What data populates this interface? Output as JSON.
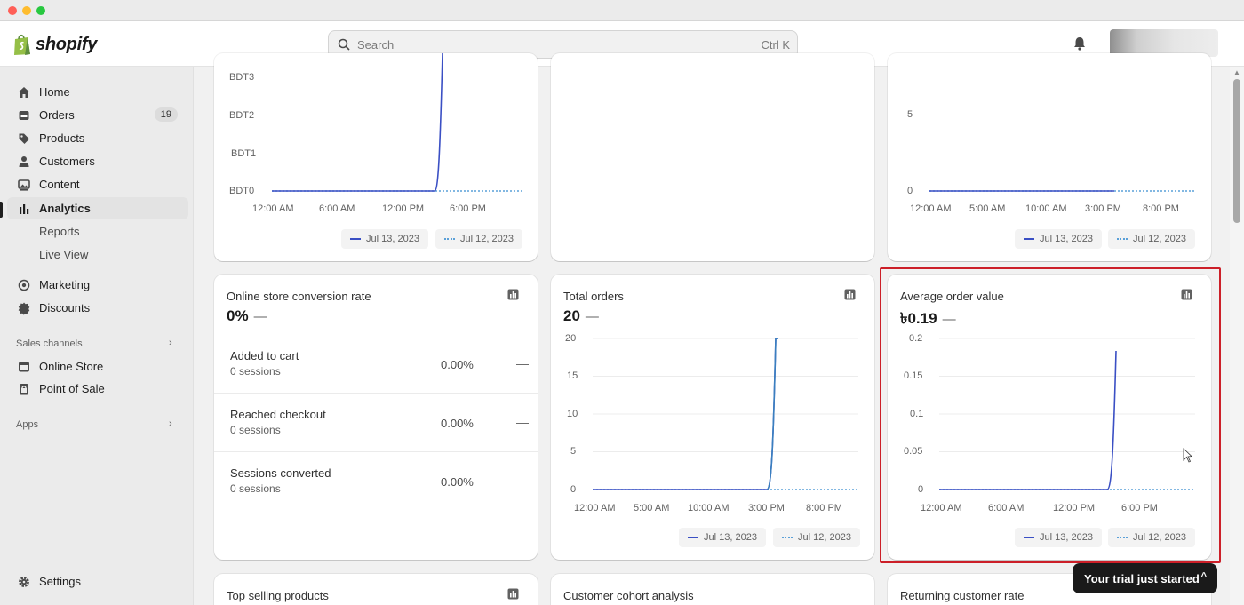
{
  "window": {
    "controls": [
      "close",
      "minimize",
      "maximize"
    ]
  },
  "topbar": {
    "logo_text": "shopify",
    "search_placeholder": "Search",
    "search_shortcut": "Ctrl K"
  },
  "sidebar": {
    "items": [
      {
        "label": "Home",
        "icon": "home-icon"
      },
      {
        "label": "Orders",
        "icon": "orders-icon",
        "badge": "19"
      },
      {
        "label": "Products",
        "icon": "tag-icon"
      },
      {
        "label": "Customers",
        "icon": "person-icon"
      },
      {
        "label": "Content",
        "icon": "image-icon"
      },
      {
        "label": "Analytics",
        "icon": "bar-chart-icon",
        "active": true
      },
      {
        "label": "Reports",
        "sub": true
      },
      {
        "label": "Live View",
        "sub": true
      },
      {
        "label": "Marketing",
        "icon": "target-icon"
      },
      {
        "label": "Discounts",
        "icon": "discount-icon"
      }
    ],
    "sales_channels_label": "Sales channels",
    "channels": [
      {
        "label": "Online Store",
        "icon": "store-icon"
      },
      {
        "label": "Point of Sale",
        "icon": "pos-icon"
      }
    ],
    "apps_label": "Apps",
    "settings_label": "Settings"
  },
  "cards": {
    "sales": {
      "y_ticks": [
        "BDT3",
        "BDT2",
        "BDT1",
        "BDT0"
      ],
      "x_ticks": [
        "12:00 AM",
        "6:00 AM",
        "12:00 PM",
        "6:00 PM"
      ],
      "legend": [
        "Jul 13, 2023",
        "Jul 12, 2023"
      ]
    },
    "sessions_right": {
      "y_ticks": [
        "5",
        "0"
      ],
      "x_ticks": [
        "12:00 AM",
        "5:00 AM",
        "10:00 AM",
        "3:00 PM",
        "8:00 PM"
      ],
      "legend": [
        "Jul 13, 2023",
        "Jul 12, 2023"
      ]
    },
    "conversion": {
      "title": "Online store conversion rate",
      "value": "0%",
      "dash": "—",
      "rows": [
        {
          "name": "Added to cart",
          "sub": "0 sessions",
          "pct": "0.00%",
          "change": "—"
        },
        {
          "name": "Reached checkout",
          "sub": "0 sessions",
          "pct": "0.00%",
          "change": "—"
        },
        {
          "name": "Sessions converted",
          "sub": "0 sessions",
          "pct": "0.00%",
          "change": "—"
        }
      ]
    },
    "total_orders": {
      "title": "Total orders",
      "value": "20",
      "dash": "—",
      "y_ticks": [
        "20",
        "15",
        "10",
        "5",
        "0"
      ],
      "x_ticks": [
        "12:00 AM",
        "5:00 AM",
        "10:00 AM",
        "3:00 PM",
        "8:00 PM"
      ],
      "legend": [
        "Jul 13, 2023",
        "Jul 12, 2023"
      ]
    },
    "avg_order": {
      "title": "Average order value",
      "value": "৳0.19",
      "dash": "—",
      "y_ticks": [
        "0.2",
        "0.15",
        "0.1",
        "0.05",
        "0"
      ],
      "x_ticks": [
        "12:00 AM",
        "6:00 AM",
        "12:00 PM",
        "6:00 PM"
      ],
      "legend": [
        "Jul 13, 2023",
        "Jul 12, 2023"
      ]
    },
    "bottom_titles": [
      "Top selling products",
      "Customer cohort analysis",
      "Returning customer rate"
    ]
  },
  "toast": {
    "label": "Your trial just started",
    "caret": "^"
  },
  "colors": {
    "series_current": "#3a4fc4",
    "series_previous": "#5aa0d8",
    "highlight": "#cc1f28"
  }
}
